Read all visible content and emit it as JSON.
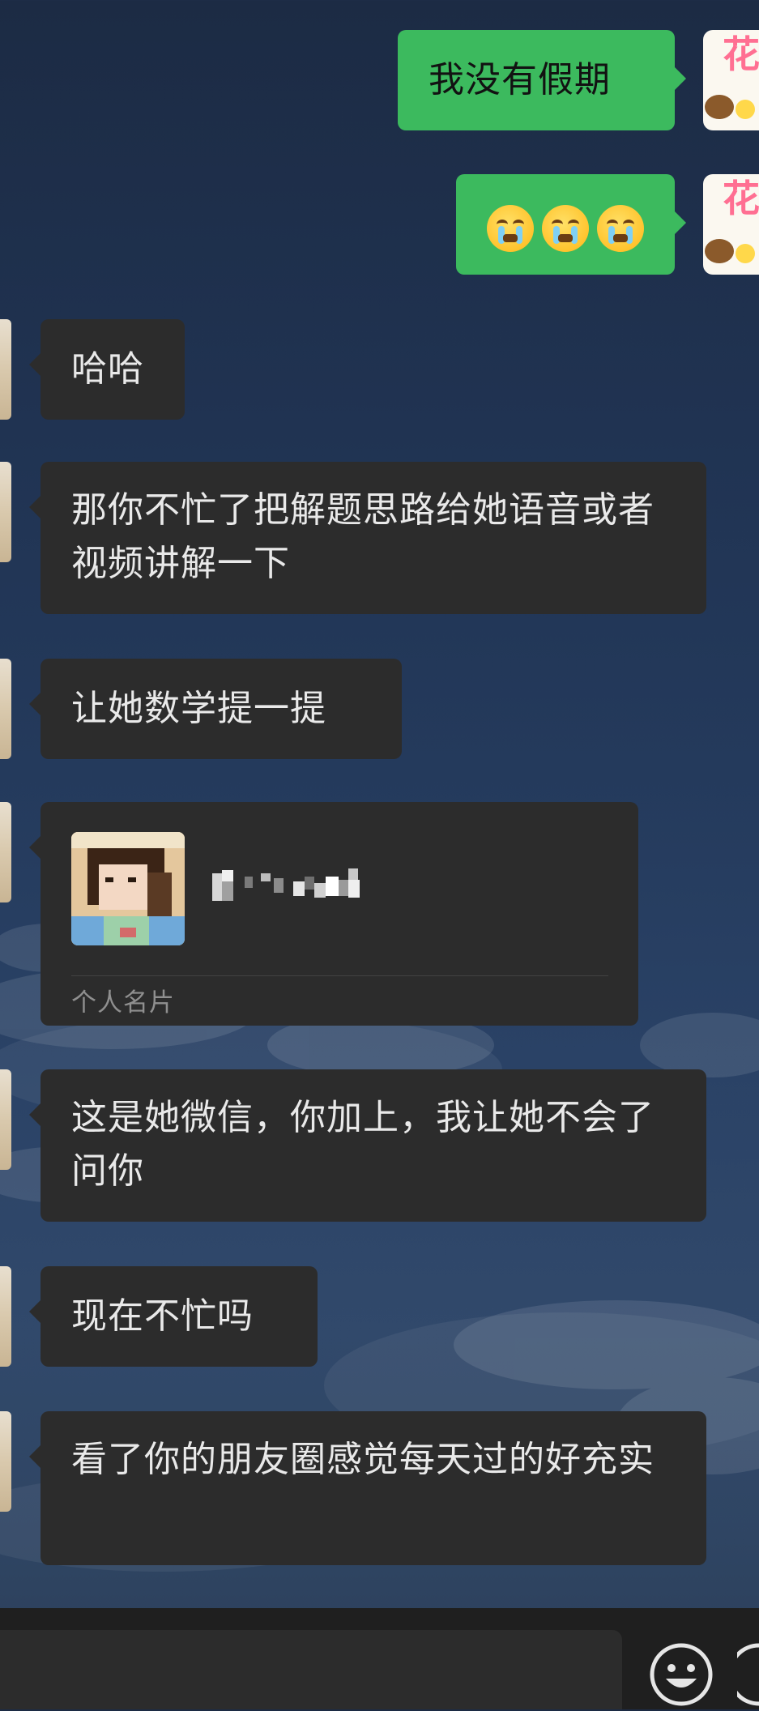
{
  "messages": {
    "m1": "我没有假期",
    "m3": "哈哈",
    "m4": "那你不忙了把解题思路给她语音或者视频讲解一下",
    "m5": "让她数学提一提",
    "m7": "这是她微信，你加上，我让她不会了问你",
    "m8": "现在不忙吗",
    "m9": "看了你的朋友圈感觉每天过的好充实"
  },
  "card": {
    "label": "个人名片"
  },
  "avatar_right": {
    "text": "花"
  },
  "icons": {
    "emoji_reaction": "crying-face-emoji",
    "input_emoji": "smiley-icon",
    "input_more": "more-icon"
  },
  "colors": {
    "out_bubble": "#3cba5e",
    "in_bubble": "#2c2c2c",
    "in_text": "#e9e9e9",
    "card_label": "#8f8f8f"
  }
}
